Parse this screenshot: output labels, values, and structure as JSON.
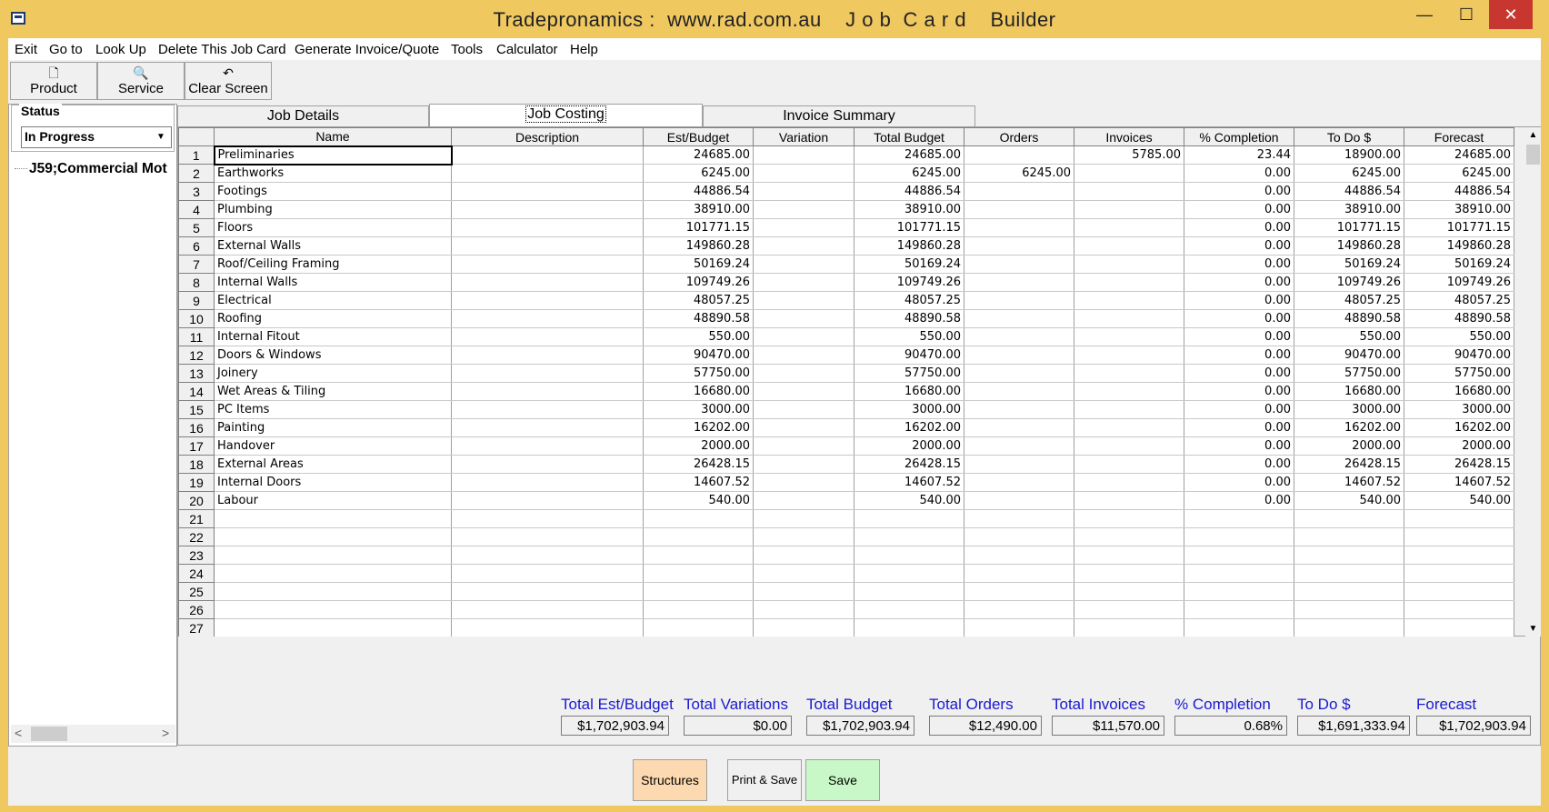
{
  "window": {
    "title": "Tradepronamics :  www.rad.com.au    J o b  C a r d    Builder",
    "minimize": "—",
    "maximize": "☐",
    "close": "✕"
  },
  "menu": [
    "Exit",
    "Go to",
    "Look Up",
    "Delete This Job Card",
    "Generate Invoice/Quote",
    "Tools",
    "Calculator",
    "Help"
  ],
  "toolbar": {
    "product": "Product",
    "service": "Service",
    "clear": "Clear Screen"
  },
  "status": {
    "legend": "Status",
    "value": "In Progress"
  },
  "tree": {
    "node": "J59;Commercial Mot"
  },
  "tabs": [
    "Job Details",
    "Job Costing",
    "Invoice Summary"
  ],
  "grid": {
    "headers": [
      "Name",
      "Description",
      "Est/Budget",
      "Variation",
      "Total Budget",
      "Orders",
      "Invoices",
      "% Completion",
      "To Do $",
      "Forecast"
    ],
    "rows": [
      [
        "1",
        "Preliminaries",
        "",
        "24685.00",
        "",
        "24685.00",
        "",
        "5785.00",
        "23.44",
        "18900.00",
        "24685.00"
      ],
      [
        "2",
        "Earthworks",
        "",
        "6245.00",
        "",
        "6245.00",
        "6245.00",
        "",
        "0.00",
        "6245.00",
        "6245.00"
      ],
      [
        "3",
        "Footings",
        "",
        "44886.54",
        "",
        "44886.54",
        "",
        "",
        "0.00",
        "44886.54",
        "44886.54"
      ],
      [
        "4",
        "Plumbing",
        "",
        "38910.00",
        "",
        "38910.00",
        "",
        "",
        "0.00",
        "38910.00",
        "38910.00"
      ],
      [
        "5",
        "Floors",
        "",
        "101771.15",
        "",
        "101771.15",
        "",
        "",
        "0.00",
        "101771.15",
        "101771.15"
      ],
      [
        "6",
        "External Walls",
        "",
        "149860.28",
        "",
        "149860.28",
        "",
        "",
        "0.00",
        "149860.28",
        "149860.28"
      ],
      [
        "7",
        "Roof/Ceiling Framing",
        "",
        "50169.24",
        "",
        "50169.24",
        "",
        "",
        "0.00",
        "50169.24",
        "50169.24"
      ],
      [
        "8",
        "Internal Walls",
        "",
        "109749.26",
        "",
        "109749.26",
        "",
        "",
        "0.00",
        "109749.26",
        "109749.26"
      ],
      [
        "9",
        "Electrical",
        "",
        "48057.25",
        "",
        "48057.25",
        "",
        "",
        "0.00",
        "48057.25",
        "48057.25"
      ],
      [
        "10",
        "Roofing",
        "",
        "48890.58",
        "",
        "48890.58",
        "",
        "",
        "0.00",
        "48890.58",
        "48890.58"
      ],
      [
        "11",
        "Internal Fitout",
        "",
        "550.00",
        "",
        "550.00",
        "",
        "",
        "0.00",
        "550.00",
        "550.00"
      ],
      [
        "12",
        "Doors & Windows",
        "",
        "90470.00",
        "",
        "90470.00",
        "",
        "",
        "0.00",
        "90470.00",
        "90470.00"
      ],
      [
        "13",
        "Joinery",
        "",
        "57750.00",
        "",
        "57750.00",
        "",
        "",
        "0.00",
        "57750.00",
        "57750.00"
      ],
      [
        "14",
        "Wet Areas & Tiling",
        "",
        "16680.00",
        "",
        "16680.00",
        "",
        "",
        "0.00",
        "16680.00",
        "16680.00"
      ],
      [
        "15",
        "PC Items",
        "",
        "3000.00",
        "",
        "3000.00",
        "",
        "",
        "0.00",
        "3000.00",
        "3000.00"
      ],
      [
        "16",
        "Painting",
        "",
        "16202.00",
        "",
        "16202.00",
        "",
        "",
        "0.00",
        "16202.00",
        "16202.00"
      ],
      [
        "17",
        "Handover",
        "",
        "2000.00",
        "",
        "2000.00",
        "",
        "",
        "0.00",
        "2000.00",
        "2000.00"
      ],
      [
        "18",
        "External Areas",
        "",
        "26428.15",
        "",
        "26428.15",
        "",
        "",
        "0.00",
        "26428.15",
        "26428.15"
      ],
      [
        "19",
        "Internal Doors",
        "",
        "14607.52",
        "",
        "14607.52",
        "",
        "",
        "0.00",
        "14607.52",
        "14607.52"
      ],
      [
        "20",
        "Labour",
        "",
        "540.00",
        "",
        "540.00",
        "",
        "",
        "0.00",
        "540.00",
        "540.00"
      ],
      [
        "21",
        "",
        "",
        "",
        "",
        "",
        "",
        "",
        "",
        "",
        ""
      ],
      [
        "22",
        "",
        "",
        "",
        "",
        "",
        "",
        "",
        "",
        "",
        ""
      ],
      [
        "23",
        "",
        "",
        "",
        "",
        "",
        "",
        "",
        "",
        "",
        ""
      ],
      [
        "24",
        "",
        "",
        "",
        "",
        "",
        "",
        "",
        "",
        "",
        ""
      ],
      [
        "25",
        "",
        "",
        "",
        "",
        "",
        "",
        "",
        "",
        "",
        ""
      ],
      [
        "26",
        "",
        "",
        "",
        "",
        "",
        "",
        "",
        "",
        "",
        ""
      ],
      [
        "27",
        "",
        "",
        "",
        "",
        "",
        "",
        "",
        "",
        "",
        ""
      ]
    ]
  },
  "totals": [
    {
      "label": "Total Est/Budget",
      "value": "$1,702,903.94"
    },
    {
      "label": "Total Variations",
      "value": "$0.00"
    },
    {
      "label": "Total Budget",
      "value": "$1,702,903.94"
    },
    {
      "label": "Total Orders",
      "value": "$12,490.00"
    },
    {
      "label": "Total Invoices",
      "value": "$11,570.00"
    },
    {
      "label": "% Completion",
      "value": "0.68%"
    },
    {
      "label": "To Do $",
      "value": "$1,691,333.94"
    },
    {
      "label": "Forecast",
      "value": "$1,702,903.94"
    }
  ],
  "buttons": {
    "structures": "Structures",
    "print_save": "Print & Save",
    "save": "Save"
  },
  "colors": {
    "title_bar": "#f0c860",
    "close_button": "#c7372f",
    "totals_label": "#1a1ad0",
    "structures_button": "#fcd9b0",
    "save_button": "#c8f8c8"
  }
}
